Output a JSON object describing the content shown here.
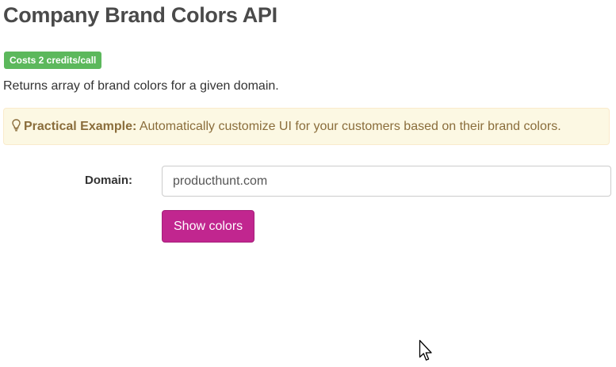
{
  "page": {
    "title": "Company Brand Colors API",
    "cost_badge": "Costs 2 credits/call",
    "description": "Returns array of brand colors for a given domain."
  },
  "example": {
    "icon": "lightbulb-icon",
    "label": "Practical Example:",
    "text": " Automatically customize UI for your customers based on their brand colors."
  },
  "form": {
    "domain_label": "Domain:",
    "domain_value": "producthunt.com",
    "submit_label": "Show colors"
  },
  "colors": {
    "badge": "#5cb85c",
    "example_bg": "#fcf8e3",
    "example_text": "#8a6d3b",
    "button": "#c1268f"
  }
}
